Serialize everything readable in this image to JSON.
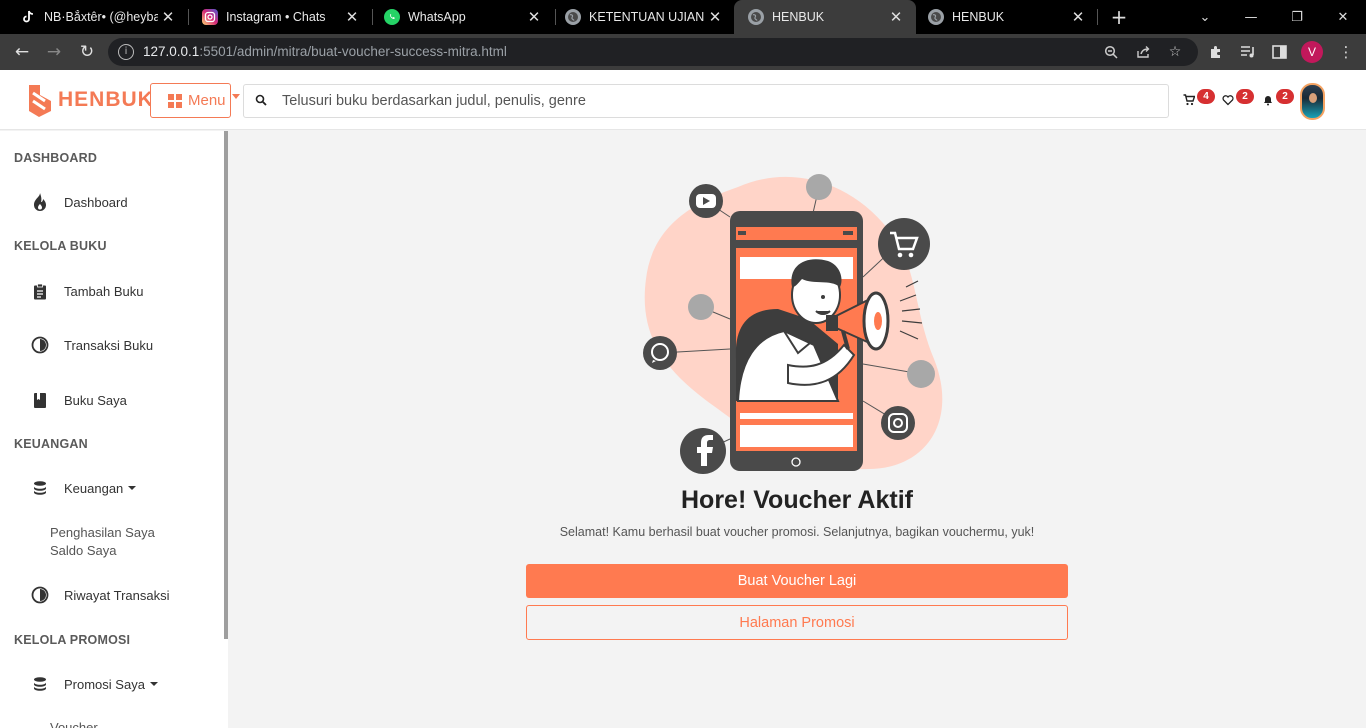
{
  "browser": {
    "tabs": [
      {
        "title": "NB·Bẳxtêr• (@heybax",
        "favicon": "tiktok-icon",
        "color": "#000000",
        "active": false
      },
      {
        "title": "Instagram • Chats",
        "favicon": "instagram-icon",
        "color": "#d62976",
        "active": false
      },
      {
        "title": "WhatsApp",
        "favicon": "whatsapp-icon",
        "color": "#25d366",
        "active": false
      },
      {
        "title": "KETENTUAN UJIAN PR",
        "favicon": "globe-icon",
        "color": "#9aa0a6",
        "active": false
      },
      {
        "title": "HENBUK",
        "favicon": "globe-icon",
        "color": "#9aa0a6",
        "active": true
      },
      {
        "title": "HENBUK",
        "favicon": "globe-icon",
        "color": "#9aa0a6",
        "active": false
      }
    ],
    "url_host": "127.0.0.1",
    "url_rest": ":5501/admin/mitra/buat-voucher-success-mitra.html",
    "profile_initial": "V"
  },
  "header": {
    "logo_text": "HENBUK",
    "menu_label": "Menu",
    "search_placeholder": "Telusuri buku berdasarkan judul, penulis, genre",
    "cart_count": "4",
    "wishlist_count": "2",
    "notification_count": "2"
  },
  "sidebar": {
    "sections": {
      "dashboard": "DASHBOARD",
      "kelola_buku": "KELOLA BUKU",
      "keuangan": "KEUANGAN",
      "kelola_promosi": "KELOLA PROMOSI"
    },
    "items": {
      "dashboard": "Dashboard",
      "tambah_buku": "Tambah Buku",
      "transaksi_buku": "Transaksi Buku",
      "buku_saya": "Buku Saya",
      "keuangan": "Keuangan",
      "penghasilan_saya": "Penghasilan Saya",
      "saldo_saya": "Saldo Saya",
      "riwayat_transaksi": "Riwayat Transaksi",
      "promosi_saya": "Promosi Saya",
      "voucher": "Voucher"
    }
  },
  "main": {
    "title": "Hore! Voucher Aktif",
    "subtitle": "Selamat! Kamu berhasil buat voucher promosi. Selanjutnya, bagikan vouchermu, yuk!",
    "primary_button": "Buat Voucher Lagi",
    "secondary_button": "Halaman Promosi"
  },
  "colors": {
    "brand": "#ff7a50",
    "badge": "#d63031",
    "blob": "#ffd4c8"
  }
}
